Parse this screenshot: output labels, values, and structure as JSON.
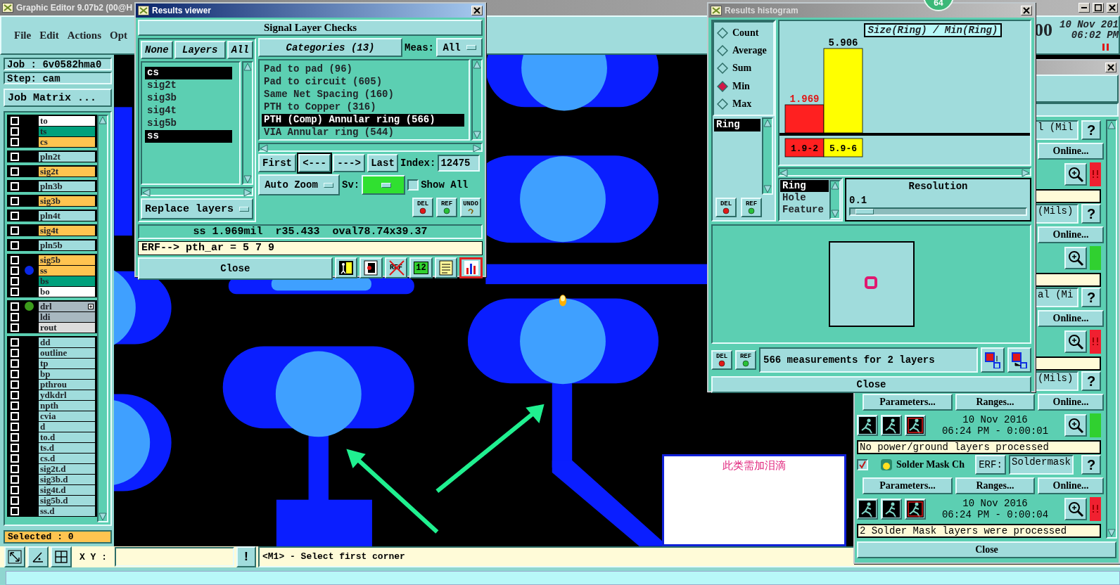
{
  "main_window": {
    "title": "Graphic Editor 9.07b2 (00@H",
    "menus": [
      "File",
      "Edit",
      "Actions",
      "Opt"
    ],
    "clock_fragment": "00",
    "date": "10 Nov 201",
    "time": "06:02 PM"
  },
  "job": {
    "job_label": "Job : 6v0582hma0",
    "step_label": "Step: cam",
    "matrix_button": "Job Matrix ..."
  },
  "layer_groups": [
    [
      {
        "name": "to",
        "color": "#ffffff",
        "checked": false
      },
      {
        "name": "ts",
        "color": "#00a07c",
        "checked": false
      },
      {
        "name": "cs",
        "color": "#ffc450",
        "checked": false
      }
    ],
    [
      {
        "name": "pln2t",
        "color": "#a0dcdc",
        "checked": false
      }
    ],
    [
      {
        "name": "sig2t",
        "color": "#ffc450",
        "checked": false
      }
    ],
    [
      {
        "name": "pln3b",
        "color": "#a0dcdc",
        "checked": false
      }
    ],
    [
      {
        "name": "sig3b",
        "color": "#ffc450",
        "checked": false
      }
    ],
    [
      {
        "name": "pln4t",
        "color": "#a0dcdc",
        "checked": false
      }
    ],
    [
      {
        "name": "sig4t",
        "color": "#ffc450",
        "checked": false
      }
    ],
    [
      {
        "name": "pln5b",
        "color": "#a0dcdc",
        "checked": false
      }
    ],
    [
      {
        "name": "sig5b",
        "color": "#ffc450",
        "checked": false
      },
      {
        "name": "ss",
        "color": "#ffc450",
        "checked": false,
        "dot": {
          "color": "#0a28e6"
        }
      },
      {
        "name": "bs",
        "color": "#00a07c",
        "checked": false
      },
      {
        "name": "bo",
        "color": "#ffffff",
        "checked": false
      }
    ],
    [
      {
        "name": "drl",
        "color": "#a8b8c0",
        "checked": false,
        "dot": {
          "color": "#3c9c1c"
        },
        "expandable": true
      },
      {
        "name": "ldi",
        "color": "#a8b8c0",
        "checked": false
      },
      {
        "name": "rout",
        "color": "#dcdcdc",
        "checked": false
      }
    ],
    [
      {
        "name": "dd",
        "color": "#a0dcdc",
        "checked": false
      },
      {
        "name": "outline",
        "color": "#a0dcdc",
        "checked": false
      },
      {
        "name": "tp",
        "color": "#a0dcdc",
        "checked": false
      },
      {
        "name": "bp",
        "color": "#a0dcdc",
        "checked": false
      },
      {
        "name": "pthrou",
        "color": "#a0dcdc",
        "checked": false
      },
      {
        "name": "ydkdrl",
        "color": "#a0dcdc",
        "checked": false
      },
      {
        "name": "npth",
        "color": "#a0dcdc",
        "checked": false
      },
      {
        "name": "cvia",
        "color": "#a0dcdc",
        "checked": false
      },
      {
        "name": "d",
        "color": "#a0dcdc",
        "checked": false
      },
      {
        "name": "to.d",
        "color": "#a0dcdc",
        "checked": false
      },
      {
        "name": "ts.d",
        "color": "#a0dcdc",
        "checked": false
      },
      {
        "name": "cs.d",
        "color": "#a0dcdc",
        "checked": false
      },
      {
        "name": "sig2t.d",
        "color": "#a0dcdc",
        "checked": false
      },
      {
        "name": "sig3b.d",
        "color": "#a0dcdc",
        "checked": false
      },
      {
        "name": "sig4t.d",
        "color": "#a0dcdc",
        "checked": false
      },
      {
        "name": "sig5b.d",
        "color": "#a0dcdc",
        "checked": false
      },
      {
        "name": "ss.d",
        "color": "#a0dcdc",
        "checked": false
      }
    ]
  ],
  "selected_count": "Selected : 0",
  "bottom_bar": {
    "coords_label": "X Y :",
    "alert_button": "!",
    "message": "<M1> - Select first corner"
  },
  "canvas": {
    "annotation": "此类需加泪滴"
  },
  "results_viewer": {
    "title": "Results viewer",
    "heading": "Signal Layer Checks",
    "layer_buttons": [
      "None",
      "Layers",
      "All"
    ],
    "layers": [
      {
        "name": "cs",
        "selected": true
      },
      {
        "name": "sig2t",
        "selected": false
      },
      {
        "name": "sig3b",
        "selected": false
      },
      {
        "name": "sig4t",
        "selected": false
      },
      {
        "name": "sig5b",
        "selected": false
      },
      {
        "name": "ss",
        "selected": true
      }
    ],
    "layer_action": "Replace layers",
    "categories_button": "Categories (13)",
    "meas_label": "Meas:",
    "meas_value": "All",
    "categories": [
      {
        "label": "Pad to pad (96)",
        "selected": false
      },
      {
        "label": "Pad to circuit (605)",
        "selected": false
      },
      {
        "label": "Same Net Spacing (160)",
        "selected": false
      },
      {
        "label": "PTH to Copper (316)",
        "selected": false
      },
      {
        "label": "PTH (Comp) Annular ring (566)",
        "selected": true
      },
      {
        "label": "VIA Annular ring (544)",
        "selected": false
      }
    ],
    "nav_buttons": [
      {
        "label": "First",
        "pressed": false
      },
      {
        "label": "<---",
        "pressed": true
      },
      {
        "label": "--->",
        "pressed": false
      },
      {
        "label": "Last",
        "pressed": false
      }
    ],
    "index_label": "Index:",
    "index_value": "12475",
    "zoom_mode": "Auto Zoom",
    "sv_label": "Sv:",
    "show_all": {
      "label": "Show All",
      "checked": false
    },
    "edit_buttons": [
      "DEL",
      "REF",
      "UNDO"
    ],
    "measurement": "ss 1.969mil  r35.433  oval78.74x39.37",
    "erf_line": "ERF--> pth_ar = 5 7 9",
    "close": "Close",
    "tools": [
      {
        "kind": "figure",
        "selected": false
      },
      {
        "kind": "flag",
        "selected": false
      },
      {
        "kind": "crossed",
        "label": "REF",
        "selected": false
      },
      {
        "kind": "counter",
        "label": "12",
        "selected": false
      },
      {
        "kind": "note",
        "selected": false
      },
      {
        "kind": "histogram",
        "selected": true
      }
    ]
  },
  "histogram": {
    "title": "Results histogram",
    "badge": "64",
    "modes": [
      {
        "label": "Count",
        "selected": false
      },
      {
        "label": "Average",
        "selected": false
      },
      {
        "label": "Sum",
        "selected": false
      },
      {
        "label": "Min",
        "selected": true
      },
      {
        "label": "Max",
        "selected": false
      }
    ],
    "attributes": [
      {
        "label": "Ring",
        "selected": true
      }
    ],
    "list_buttons": [
      "DEL",
      "REF"
    ],
    "chart_data": {
      "type": "bar",
      "title": "Size(Ring) / Min(Ring)",
      "categories": [
        "1.9-2",
        "5.9-6"
      ],
      "values": [
        1.969,
        5.906
      ],
      "colors": [
        "#ff2020",
        "#ffff00"
      ],
      "data_labels": true
    },
    "scale_list": [
      {
        "label": "Ring",
        "selected": true
      },
      {
        "label": "Hole",
        "selected": false
      },
      {
        "label": "Feature",
        "selected": false
      }
    ],
    "resolution": {
      "label": "Resolution",
      "value": "0.1",
      "level": 0.03
    },
    "footer_buttons": [
      "DEL",
      "REF"
    ],
    "summary": "566 measurements for 2 layers",
    "close": "Close"
  },
  "checklist": {
    "sections": [
      {
        "header": {
          "kind": "partial",
          "text": "l (Mil"
        },
        "help": "?",
        "buttons": [
          "Online..."
        ],
        "passed": false
      },
      {
        "header": {
          "kind": "partial",
          "text": "(Mils)"
        },
        "help": "?",
        "buttons": [
          "Online..."
        ],
        "passed": true
      },
      {
        "header": {
          "kind": "partial",
          "text": "al (Mi"
        },
        "help": "?",
        "buttons": [
          "Online..."
        ],
        "passed": false
      },
      {
        "header": {
          "kind": "partial",
          "text": "(Mils)"
        },
        "help": "?",
        "buttons": [
          "Parameters...",
          "Ranges...",
          "Online..."
        ],
        "date": "10 Nov 2016",
        "time": "06:24 PM - 0:00:01",
        "passed": true,
        "message": "No power/ground layers processed"
      },
      {
        "header": {
          "kind": "full",
          "checked": true,
          "name": "Solder Mask Ch",
          "erf": "ERF:",
          "field": "Soldermask"
        },
        "help": "?",
        "buttons": [
          "Parameters...",
          "Ranges...",
          "Online..."
        ],
        "date": "10 Nov 2016",
        "time": "06:24 PM - 0:00:04",
        "passed": false,
        "message": "2 Solder Mask layers were processed"
      }
    ],
    "close": "Close"
  }
}
